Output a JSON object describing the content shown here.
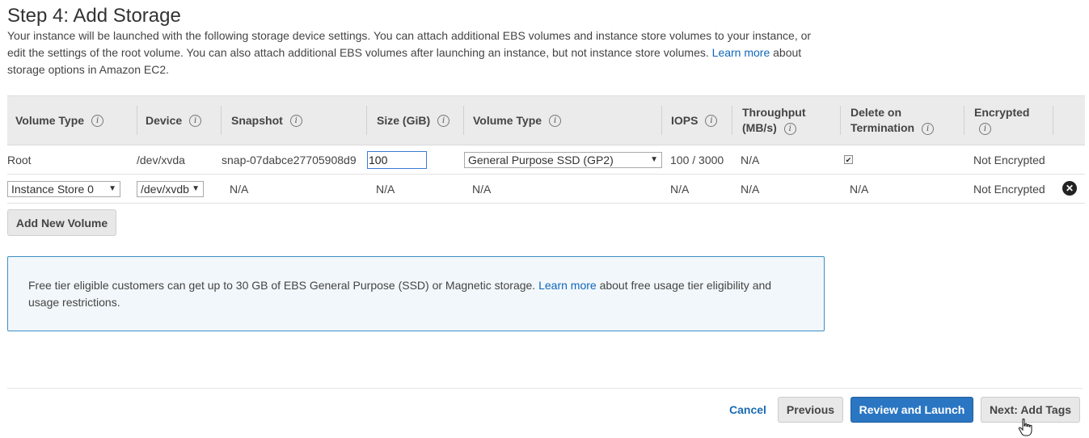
{
  "page": {
    "title": "Step 4: Add Storage",
    "intro_text": "Your instance will be launched with the following storage device settings. You can attach additional EBS volumes and instance store volumes to your instance, or edit the settings of the root volume. You can also attach additional EBS volumes after launching an instance, but not instance store volumes.",
    "intro_link": "Learn more",
    "intro_suffix": "about storage options in Amazon EC2."
  },
  "table": {
    "headers": {
      "volume_type": "Volume Type",
      "device": "Device",
      "snapshot": "Snapshot",
      "size": "Size (GiB)",
      "volume_type2": "Volume Type",
      "iops": "IOPS",
      "throughput": "Throughput (MB/s)",
      "delete_on_termination": "Delete on Termination",
      "encrypted": "Encrypted"
    },
    "rows": [
      {
        "volume_type": "Root",
        "device": "/dev/xvda",
        "snapshot": "snap-07dabce27705908d9",
        "size": "100",
        "ebs_volume_type": "General Purpose SSD (GP2)",
        "iops": "100 / 3000",
        "throughput": "N/A",
        "delete_on_termination": true,
        "encrypted": "Not Encrypted"
      },
      {
        "volume_type": "Instance Store 0",
        "device": "/dev/xvdb",
        "snapshot": "N/A",
        "size": "N/A",
        "ebs_volume_type": "N/A",
        "iops": "N/A",
        "throughput": "N/A",
        "delete_on_termination": "N/A",
        "encrypted": "Not Encrypted"
      }
    ]
  },
  "add_volume_label": "Add New Volume",
  "notice": {
    "text": "Free tier eligible customers can get up to 30 GB of EBS General Purpose (SSD) or Magnetic storage.",
    "link": "Learn more",
    "suffix": "about free usage tier eligibility and usage restrictions."
  },
  "footer": {
    "cancel": "Cancel",
    "previous": "Previous",
    "review": "Review and Launch",
    "next": "Next: Add Tags"
  },
  "icons": {
    "info": "info-icon",
    "remove": "remove-volume-icon",
    "dropdown": "dropdown-arrow-icon",
    "checkbox": "checkbox-checked"
  },
  "colors": {
    "link": "#1166bb",
    "primary_button": "#2a76c2",
    "notice_border": "#3d8fc6",
    "notice_bg": "#f1f7fb",
    "header_bg": "#ebebeb"
  }
}
